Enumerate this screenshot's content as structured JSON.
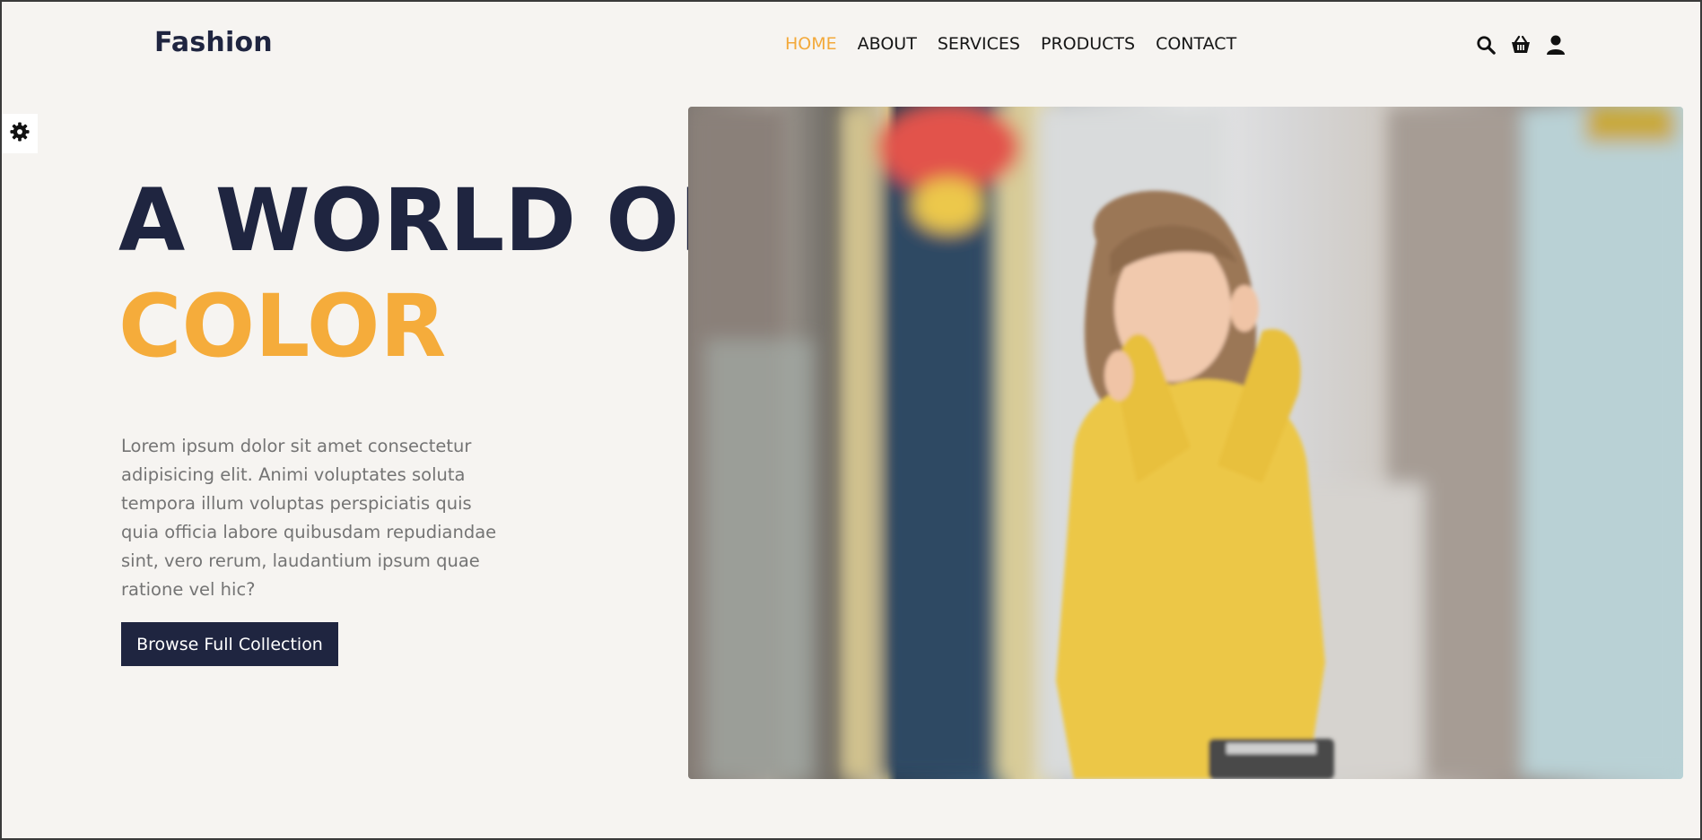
{
  "header": {
    "logo": "Fashion",
    "nav": [
      {
        "label": "HOME",
        "active": true
      },
      {
        "label": "ABOUT",
        "active": false
      },
      {
        "label": "SERVICES",
        "active": false
      },
      {
        "label": "PRODUCTS",
        "active": false
      },
      {
        "label": "CONTACT",
        "active": false
      }
    ],
    "icons": [
      "search-icon",
      "basket-icon",
      "user-icon"
    ]
  },
  "settings": {
    "icon": "gear-icon"
  },
  "hero": {
    "title_line1": "A WORLD OF",
    "title_line2": "COLOR",
    "description": "Lorem ipsum dolor sit amet consectetur adipisicing elit. Animi voluptates soluta tempora illum voluptas perspiciatis quis quia officia labore quibusdam repudiandae sint, vero rerum, laudantium ipsum quae ratione vel hic?",
    "cta_label": "Browse Full Collection"
  },
  "colors": {
    "accent": "#f5ac3b",
    "dark": "#1f2540",
    "background": "#f6f4f1"
  }
}
